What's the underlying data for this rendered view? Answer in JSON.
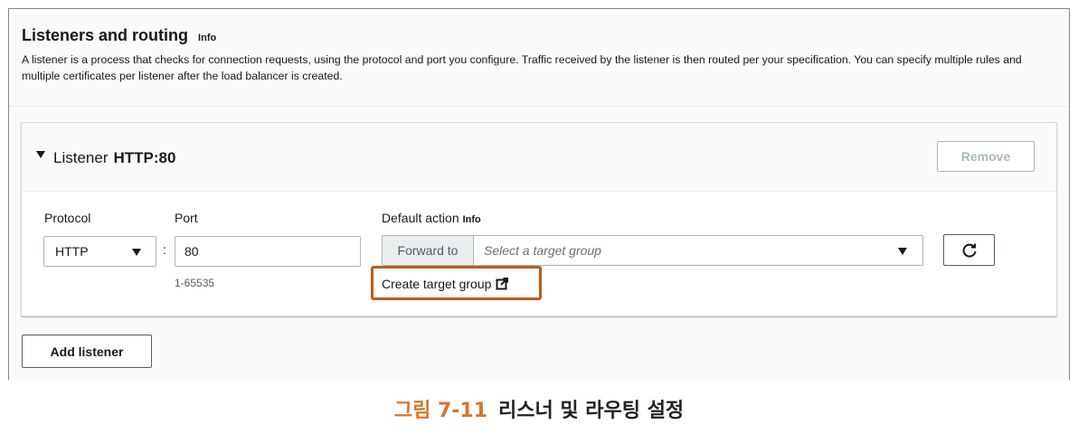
{
  "panel": {
    "title": "Listeners and routing",
    "info": "Info",
    "description": "A listener is a process that checks for connection requests, using the protocol and port you configure. Traffic received by the listener is then routed per your specification. You can specify multiple rules and multiple certificates per listener after the load balancer is created."
  },
  "listener": {
    "prefix": "Listener",
    "name": "HTTP:80",
    "remove_label": "Remove",
    "protocol_label": "Protocol",
    "protocol_value": "HTTP",
    "port_label": "Port",
    "port_value": "80",
    "port_hint": "1-65535",
    "default_action_label": "Default action",
    "default_action_info": "Info",
    "action_prefix": "Forward to",
    "action_placeholder": "Select a target group",
    "create_target_group": "Create target group"
  },
  "add_listener_label": "Add listener",
  "caption": {
    "number": "그림 7-11",
    "text": "리스너 및 라우팅 설정"
  },
  "colors": {
    "highlight": "#c15a1c",
    "caption_number": "#d9762b",
    "disabled_text": "#aab7b8"
  },
  "icons": [
    "caret-down-icon",
    "refresh-icon",
    "external-link-icon"
  ]
}
